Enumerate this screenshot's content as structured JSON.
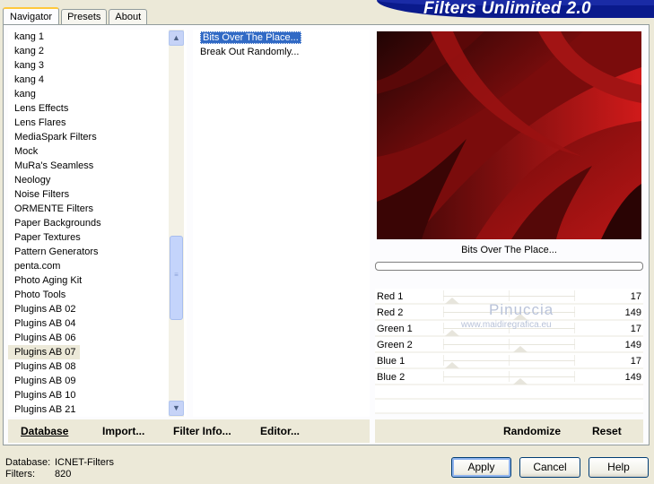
{
  "tabs": [
    {
      "label": "Navigator",
      "active": true
    },
    {
      "label": "Presets",
      "active": false
    },
    {
      "label": "About",
      "active": false
    }
  ],
  "banner": {
    "title": "Filters Unlimited 2.0"
  },
  "categories": [
    "kang 1",
    "kang 2",
    "kang 3",
    "kang 4",
    "kang",
    "Lens Effects",
    "Lens Flares",
    "MediaSpark Filters",
    "Mock",
    "MuRa's Seamless",
    "Neology",
    "Noise Filters",
    "ORMENTE Filters",
    "Paper Backgrounds",
    "Paper Textures",
    "Pattern Generators",
    "penta.com",
    "Photo Aging Kit",
    "Photo Tools",
    "Plugins AB 02",
    "Plugins AB 04",
    "Plugins AB 06",
    "Plugins AB 07",
    "Plugins AB 08",
    "Plugins AB 09",
    "Plugins AB 10",
    "Plugins AB 21"
  ],
  "selected_category": "Plugins AB 07",
  "filters": [
    {
      "label": "Bits Over The Place...",
      "selected": true
    },
    {
      "label": "Break Out Randomly...",
      "selected": false
    }
  ],
  "preview": {
    "filter_name": "Bits Over The Place..."
  },
  "sliders": [
    {
      "label": "Red 1",
      "value": "17"
    },
    {
      "label": "Red 2",
      "value": "149"
    },
    {
      "label": "Green 1",
      "value": "17"
    },
    {
      "label": "Green 2",
      "value": "149"
    },
    {
      "label": "Blue 1",
      "value": "17"
    },
    {
      "label": "Blue 2",
      "value": "149"
    }
  ],
  "watermark": {
    "name": "Pinuccia",
    "site": "www.maidiregrafica.eu"
  },
  "left_actions": {
    "database": "Database",
    "import": "Import...",
    "filter_info": "Filter Info...",
    "editor": "Editor..."
  },
  "right_actions": {
    "randomize": "Randomize",
    "reset": "Reset"
  },
  "status": {
    "database_label": "Database:",
    "database_value": "ICNET-Filters",
    "filters_label": "Filters:",
    "filters_value": "820"
  },
  "buttons": {
    "apply": "Apply",
    "cancel": "Cancel",
    "help": "Help"
  },
  "colors": {
    "selection": "#316ac5",
    "banner": "#0a1a8c",
    "preview_red": "#c01818"
  },
  "icons": {
    "scroll_up": "chevron-up-icon",
    "scroll_down": "chevron-down-icon"
  }
}
